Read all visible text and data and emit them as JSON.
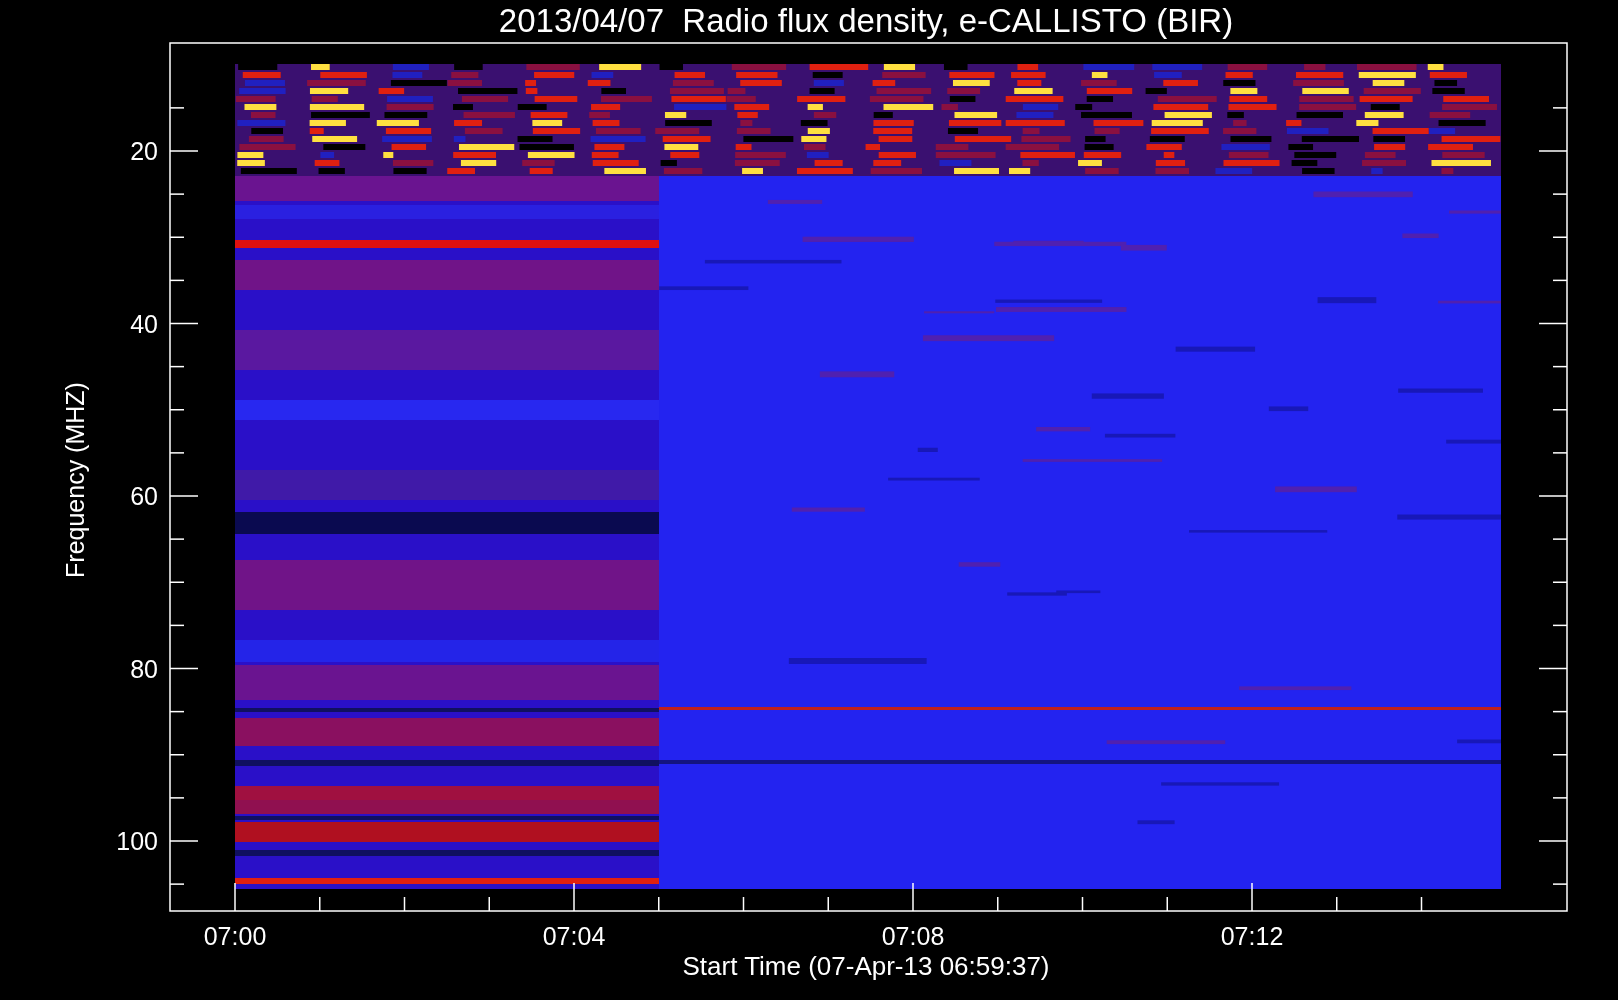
{
  "title": "2013/04/07  Radio flux density, e-CALLISTO (BIR)",
  "y_axis": {
    "label": "Frequency (MHZ)",
    "ticks": [
      "20",
      "40",
      "60",
      "80",
      "100"
    ]
  },
  "x_axis": {
    "label": "Start Time (07-Apr-13 06:59:37)",
    "ticks": [
      "07:00",
      "07:04",
      "07:08",
      "07:12"
    ]
  }
}
